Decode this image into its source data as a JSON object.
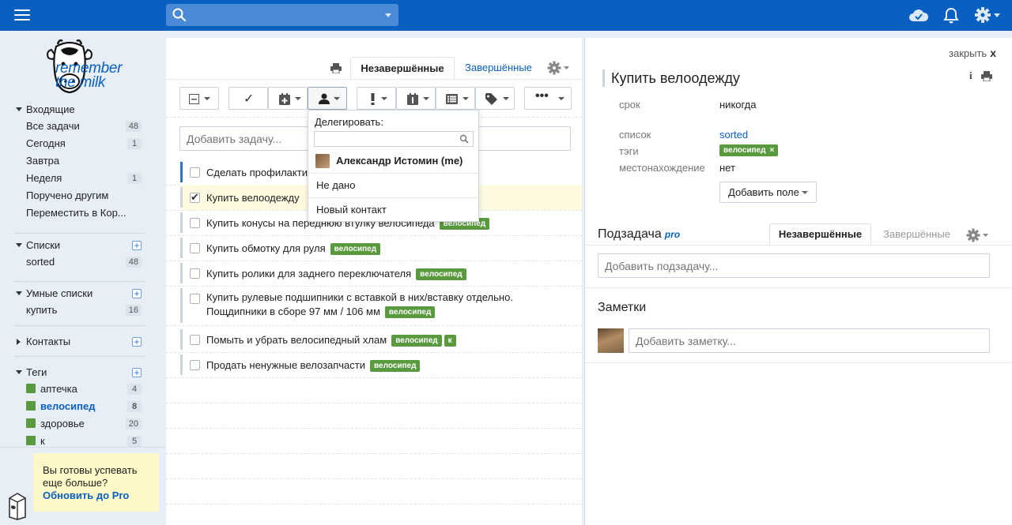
{
  "topbar": {
    "search": {
      "value": "",
      "placeholder": ""
    }
  },
  "sidebar": {
    "logo": "remember the milk",
    "inbox": {
      "title": "Входящие",
      "items": [
        {
          "label": "Все задачи",
          "count": "48"
        },
        {
          "label": "Сегодня",
          "count": "1"
        },
        {
          "label": "Завтра",
          "count": ""
        },
        {
          "label": "Неделя",
          "count": "1"
        },
        {
          "label": "Поручено другим",
          "count": ""
        },
        {
          "label": "Переместить в Кор...",
          "count": ""
        }
      ]
    },
    "lists": {
      "title": "Списки",
      "items": [
        {
          "label": "sorted",
          "count": "48"
        }
      ]
    },
    "smart": {
      "title": "Умные списки",
      "items": [
        {
          "label": "купить",
          "count": "16"
        }
      ]
    },
    "contacts": {
      "title": "Контакты"
    },
    "tags": {
      "title": "Теги",
      "items": [
        {
          "label": "аптечка",
          "count": "4"
        },
        {
          "label": "велосипед",
          "count": "8"
        },
        {
          "label": "здоровье",
          "count": "20"
        },
        {
          "label": "к",
          "count": "5"
        }
      ]
    },
    "promo": {
      "line1": "Вы готовы успевать",
      "line2": "еще больше?",
      "link": "Обновить до Pro"
    }
  },
  "tasks_panel": {
    "tab_incomplete": "Незавершённые",
    "tab_complete": "Завершённые",
    "toolbar": {
      "complete_glyph": "✓"
    },
    "add_task_placeholder": "Добавить задачу...",
    "tasks": [
      {
        "name": "Сделать профилакти",
        "tags": []
      },
      {
        "name": "Купить велоодежду",
        "tags": []
      },
      {
        "name": "Купить конусы на переднюю втулку велосипеда",
        "tags": [
          "велосипед"
        ]
      },
      {
        "name": "Купить обмотку для руля",
        "tags": [
          "велосипед"
        ]
      },
      {
        "name": "Купить ролики для заднего переключателя",
        "tags": [
          "велосипед"
        ]
      },
      {
        "name_line1": "Купить рулевые подшипники с вставкой в них/вставку отдельно.",
        "name_line2": "Пощдипники в сборе 97 мм / 106 мм",
        "tags": [
          "велосипед"
        ]
      },
      {
        "name": "Помыть и убрать велосипедный хлам",
        "tags": [
          "велосипед",
          "к"
        ]
      },
      {
        "name": "Продать ненужные велозапчасти",
        "tags": [
          "велосипед"
        ]
      }
    ]
  },
  "delegate_menu": {
    "label": "Делегировать:",
    "search_value": "",
    "me": "Александр Истомин (me)",
    "none": "Не дано",
    "new_contact": "Новый контакт"
  },
  "details": {
    "close": "закрыть",
    "close_x": "x",
    "title": "Купить велоодежду",
    "info_glyph": "i",
    "due_label": "срок",
    "due_value": "никогда",
    "list_label": "список",
    "list_value": "sorted",
    "tags_label": "тэги",
    "tag_value": "велосипед",
    "tag_remove": "×",
    "location_label": "местонахождение",
    "location_value": "нет",
    "add_field": "Добавить поле",
    "subtask_title": "Подзадача",
    "pro": "pro",
    "sub_tab_incomplete": "Незавершённые",
    "sub_tab_complete": "Завершённые",
    "add_subtask_placeholder": "Добавить подзадачу...",
    "notes_title": "Заметки",
    "add_note_placeholder": "Добавить заметку..."
  },
  "colors": {
    "topbar": "#0a60c0",
    "tag_green": "#5a9a3e",
    "link_blue": "#0a60c0",
    "selected_row": "#fdfae0",
    "promo_bg": "#fdf8c8"
  }
}
